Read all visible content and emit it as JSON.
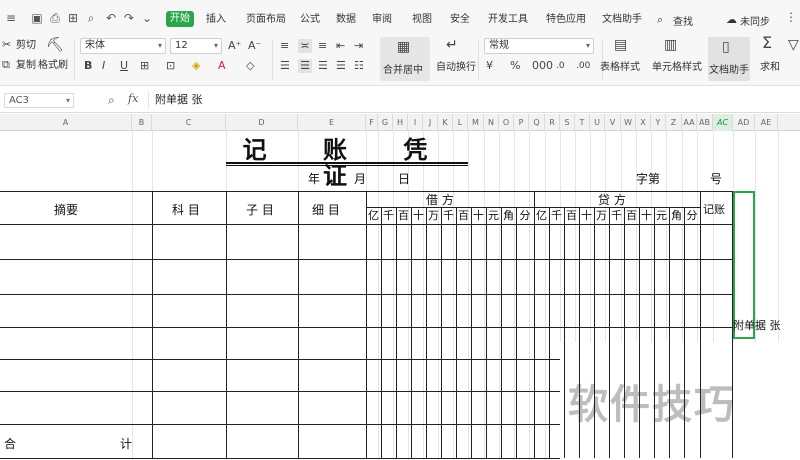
{
  "menubar": {
    "tabs": [
      {
        "label": "开始",
        "active": true
      },
      {
        "label": "插入"
      },
      {
        "label": "页面布局"
      },
      {
        "label": "公式"
      },
      {
        "label": "数据"
      },
      {
        "label": "审阅"
      },
      {
        "label": "视图"
      },
      {
        "label": "安全"
      },
      {
        "label": "开发工具"
      },
      {
        "label": "特色应用"
      },
      {
        "label": "文档助手"
      }
    ],
    "search_label": "查找",
    "share_label": "未同步"
  },
  "ribbon": {
    "cut": "剪切",
    "format_painter": "格式刷",
    "font_name": "宋体",
    "font_size": "12",
    "merge_center": "合并居中",
    "wrap_text": "自动换行",
    "number_format": "常规",
    "table_style": "表格样式",
    "cell_style": "单元格样式",
    "doc_helper": "文档助手",
    "sum": "求和"
  },
  "formula_bar": {
    "cell_ref": "AC3",
    "fx": "fx",
    "content": "附单据 张"
  },
  "columns": [
    "A",
    "B",
    "C",
    "D",
    "E",
    "F",
    "G",
    "H",
    "I",
    "J",
    "K",
    "L",
    "M",
    "N",
    "O",
    "P",
    "Q",
    "R",
    "S",
    "T",
    "U",
    "V",
    "W",
    "X",
    "Y",
    "Z",
    "AA",
    "AB",
    "AC",
    "AD",
    "AE"
  ],
  "selected_column": "AC",
  "voucher": {
    "title": "记 账 凭 证",
    "year": "年",
    "month": "月",
    "day": "日",
    "number_label": "字第",
    "number_suffix": "号",
    "col_summary": "摘要",
    "col_account": "科 目",
    "col_subaccount": "子 目",
    "col_detail": "细 目",
    "debit": "借 方",
    "credit": "贷 方",
    "posted": "记账",
    "digits": [
      "亿",
      "千",
      "百",
      "十",
      "万",
      "千",
      "百",
      "十",
      "元",
      "角",
      "分"
    ],
    "total_left": "合",
    "total_right": "计",
    "attachment_note": "附单据 张"
  },
  "watermark": "软件技巧"
}
